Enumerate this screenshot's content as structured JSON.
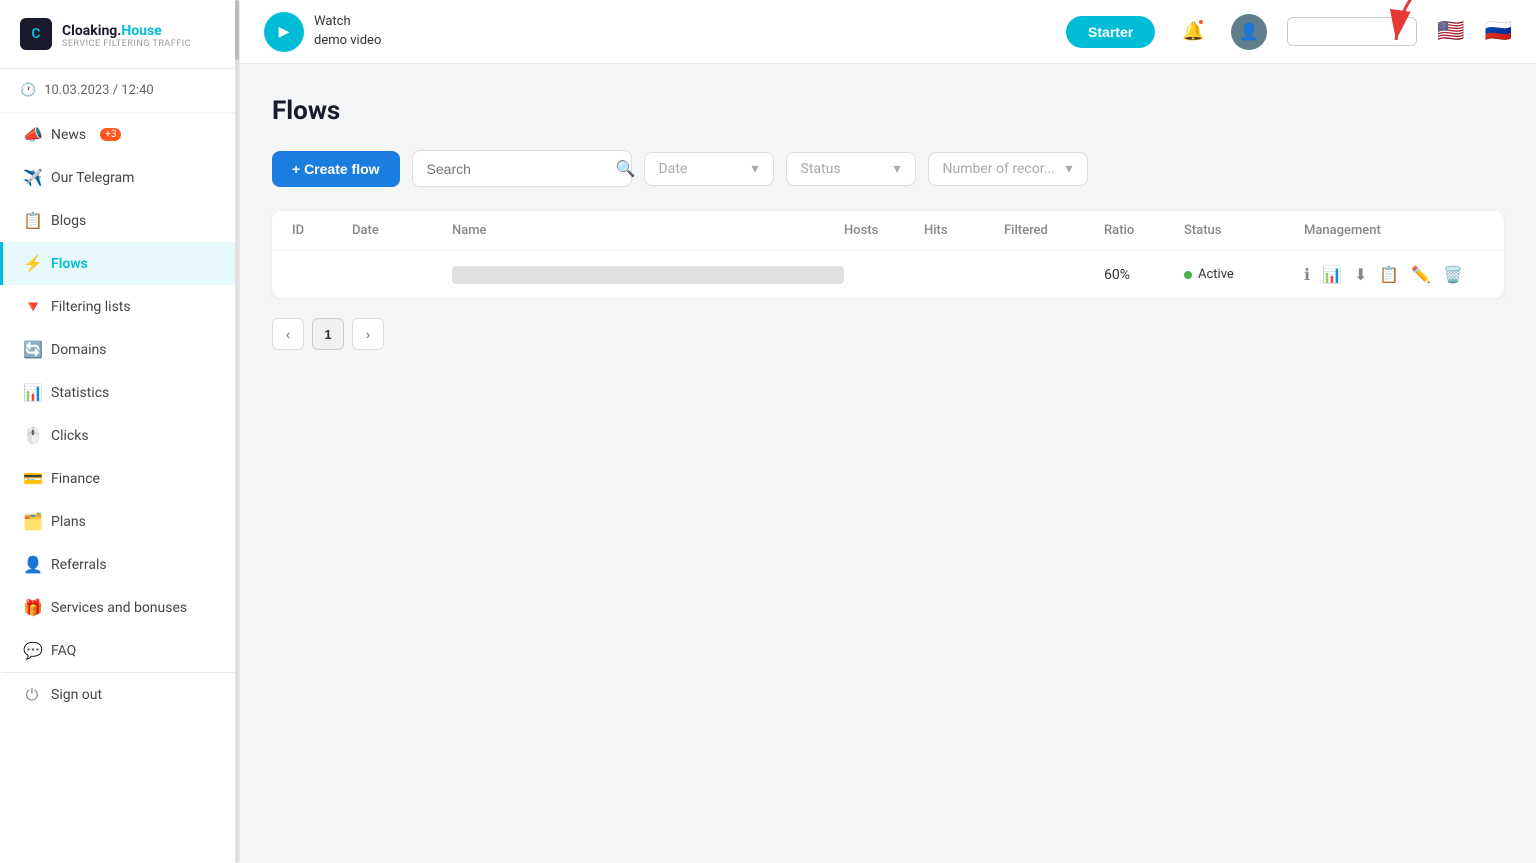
{
  "sidebar": {
    "logo": {
      "brand": "Cloaking.",
      "brand_accent": "House",
      "subtitle": "Service filtering traffic"
    },
    "datetime": "10.03.2023 / 12:40",
    "nav_items": [
      {
        "id": "news",
        "label": "News",
        "icon": "📣",
        "badge": "+3",
        "active": false
      },
      {
        "id": "telegram",
        "label": "Our Telegram",
        "icon": "✈️",
        "badge": null,
        "active": false
      },
      {
        "id": "blogs",
        "label": "Blogs",
        "icon": "📋",
        "badge": null,
        "active": false
      },
      {
        "id": "flows",
        "label": "Flows",
        "icon": "⚡",
        "badge": null,
        "active": true
      },
      {
        "id": "filtering",
        "label": "Filtering lists",
        "icon": "🔻",
        "badge": null,
        "active": false
      },
      {
        "id": "domains",
        "label": "Domains",
        "icon": "🔄",
        "badge": null,
        "active": false
      },
      {
        "id": "statistics",
        "label": "Statistics",
        "icon": "📊",
        "badge": null,
        "active": false
      },
      {
        "id": "clicks",
        "label": "Clicks",
        "icon": "🖱️",
        "badge": null,
        "active": false
      },
      {
        "id": "finance",
        "label": "Finance",
        "icon": "💳",
        "badge": null,
        "active": false
      },
      {
        "id": "plans",
        "label": "Plans",
        "icon": "🗂️",
        "badge": null,
        "active": false
      },
      {
        "id": "referrals",
        "label": "Referrals",
        "icon": "👤",
        "badge": null,
        "active": false
      },
      {
        "id": "services",
        "label": "Services and bonuses",
        "icon": "🎁",
        "badge": null,
        "active": false
      },
      {
        "id": "faq",
        "label": "FAQ",
        "icon": "💬",
        "badge": null,
        "active": false
      },
      {
        "id": "signout",
        "label": "Sign out",
        "icon": "⏻",
        "badge": null,
        "active": false
      }
    ]
  },
  "header": {
    "demo_video": {
      "line1": "Watch",
      "line2": "demo video"
    },
    "starter_label": "Starter",
    "lang_placeholder": ""
  },
  "page": {
    "title": "Flows",
    "create_btn": "+ Create flow",
    "search_placeholder": "Search",
    "date_placeholder": "Date",
    "status_placeholder": "Status",
    "records_placeholder": "Number of recor..."
  },
  "table": {
    "columns": [
      "ID",
      "Date",
      "Name",
      "Hosts",
      "Hits",
      "Filtered",
      "Ratio",
      "Status",
      "Management"
    ],
    "rows": [
      {
        "id": "",
        "date": "",
        "name": "",
        "hosts": "",
        "hits": "",
        "filtered": "",
        "ratio": "60%",
        "status": "Active",
        "status_color": "#4caf50"
      }
    ]
  },
  "pagination": {
    "prev": "‹",
    "current": "1",
    "next": "›"
  },
  "flags": {
    "en": "🇺🇸",
    "ru": "🇷🇺"
  }
}
